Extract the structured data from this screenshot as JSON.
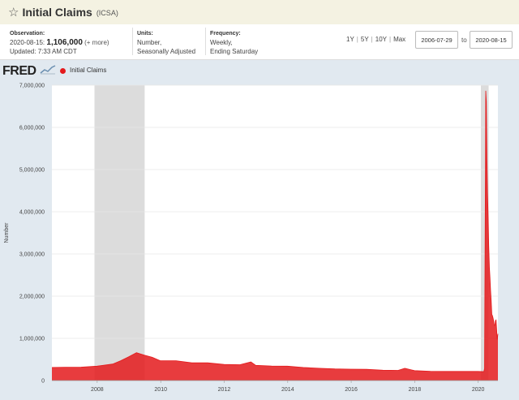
{
  "header": {
    "star_icon": "star-outline-icon",
    "title": "Initial Claims",
    "series_id": "(ICSA)"
  },
  "meta": {
    "observation_label": "Observation:",
    "observation_date": "2020-08-15:",
    "observation_value": "1,106,000",
    "more_link": "(+ more)",
    "updated": "Updated: 7:33 AM CDT",
    "units_label": "Units:",
    "units_line1": "Number,",
    "units_line2": "Seasonally Adjusted",
    "frequency_label": "Frequency:",
    "frequency_line1": "Weekly,",
    "frequency_line2": "Ending Saturday"
  },
  "range": {
    "links": [
      "1Y",
      "5Y",
      "10Y",
      "Max"
    ],
    "start_date": "2006-07-29",
    "to_label": "to",
    "end_date": "2020-08-15"
  },
  "brand": {
    "logo_text": "FRED",
    "legend_label": "Initial Claims"
  },
  "colors": {
    "series": "#e41a1c",
    "recession": "#dcdcdc",
    "plot_bg": "#ffffff",
    "chart_bg": "#e1e9f0"
  },
  "chart_data": {
    "type": "area",
    "title": "",
    "ylabel": "Number",
    "xlabel": "",
    "ylim": [
      0,
      7000000
    ],
    "xlim": [
      "2006-07-29",
      "2020-08-15"
    ],
    "y_ticks": [
      0,
      1000000,
      2000000,
      3000000,
      4000000,
      5000000,
      6000000,
      7000000
    ],
    "y_tick_labels": [
      "0",
      "1,000,000",
      "2,000,000",
      "3,000,000",
      "4,000,000",
      "5,000,000",
      "6,000,000",
      "7,000,000"
    ],
    "x_ticks": [
      "2008-01-01",
      "2010-01-01",
      "2012-01-01",
      "2014-01-01",
      "2016-01-01",
      "2018-01-01",
      "2020-01-01"
    ],
    "x_tick_labels": [
      "2008",
      "2010",
      "2012",
      "2014",
      "2016",
      "2018",
      "2020"
    ],
    "grid": true,
    "recessions": [
      {
        "start": "2007-12-01",
        "end": "2009-06-30"
      },
      {
        "start": "2020-02-01",
        "end": "2020-04-30"
      }
    ],
    "series": [
      {
        "name": "Initial Claims",
        "points": [
          [
            "2006-07-29",
            310000
          ],
          [
            "2006-12-30",
            315000
          ],
          [
            "2007-06-30",
            318000
          ],
          [
            "2007-12-29",
            340000
          ],
          [
            "2008-06-28",
            390000
          ],
          [
            "2008-09-27",
            470000
          ],
          [
            "2008-12-27",
            560000
          ],
          [
            "2009-03-28",
            660000
          ],
          [
            "2009-06-27",
            600000
          ],
          [
            "2009-09-26",
            550000
          ],
          [
            "2009-12-26",
            470000
          ],
          [
            "2010-06-26",
            470000
          ],
          [
            "2010-12-25",
            420000
          ],
          [
            "2011-06-25",
            420000
          ],
          [
            "2011-12-31",
            380000
          ],
          [
            "2012-06-30",
            375000
          ],
          [
            "2012-11-03",
            440000
          ],
          [
            "2012-12-29",
            360000
          ],
          [
            "2013-06-29",
            345000
          ],
          [
            "2013-12-28",
            340000
          ],
          [
            "2014-06-28",
            310000
          ],
          [
            "2014-12-27",
            290000
          ],
          [
            "2015-06-27",
            275000
          ],
          [
            "2015-12-26",
            270000
          ],
          [
            "2016-06-25",
            265000
          ],
          [
            "2016-12-31",
            245000
          ],
          [
            "2017-06-24",
            240000
          ],
          [
            "2017-09-09",
            290000
          ],
          [
            "2017-12-30",
            235000
          ],
          [
            "2018-06-30",
            220000
          ],
          [
            "2018-12-29",
            215000
          ],
          [
            "2019-06-29",
            215000
          ],
          [
            "2019-12-28",
            215000
          ],
          [
            "2020-03-07",
            211000
          ],
          [
            "2020-03-14",
            282000
          ],
          [
            "2020-03-21",
            3307000
          ],
          [
            "2020-03-28",
            6867000
          ],
          [
            "2020-04-04",
            6615000
          ],
          [
            "2020-04-11",
            5237000
          ],
          [
            "2020-04-18",
            4442000
          ],
          [
            "2020-04-25",
            3867000
          ],
          [
            "2020-05-02",
            3176000
          ],
          [
            "2020-05-09",
            2687000
          ],
          [
            "2020-05-16",
            2446000
          ],
          [
            "2020-05-23",
            2123000
          ],
          [
            "2020-05-30",
            1897000
          ],
          [
            "2020-06-06",
            1566000
          ],
          [
            "2020-06-13",
            1540000
          ],
          [
            "2020-06-20",
            1482000
          ],
          [
            "2020-06-27",
            1413000
          ],
          [
            "2020-07-04",
            1310000
          ],
          [
            "2020-07-11",
            1307000
          ],
          [
            "2020-07-18",
            1422000
          ],
          [
            "2020-07-25",
            1435000
          ],
          [
            "2020-08-01",
            1191000
          ],
          [
            "2020-08-08",
            971000
          ],
          [
            "2020-08-15",
            1106000
          ]
        ]
      }
    ]
  }
}
